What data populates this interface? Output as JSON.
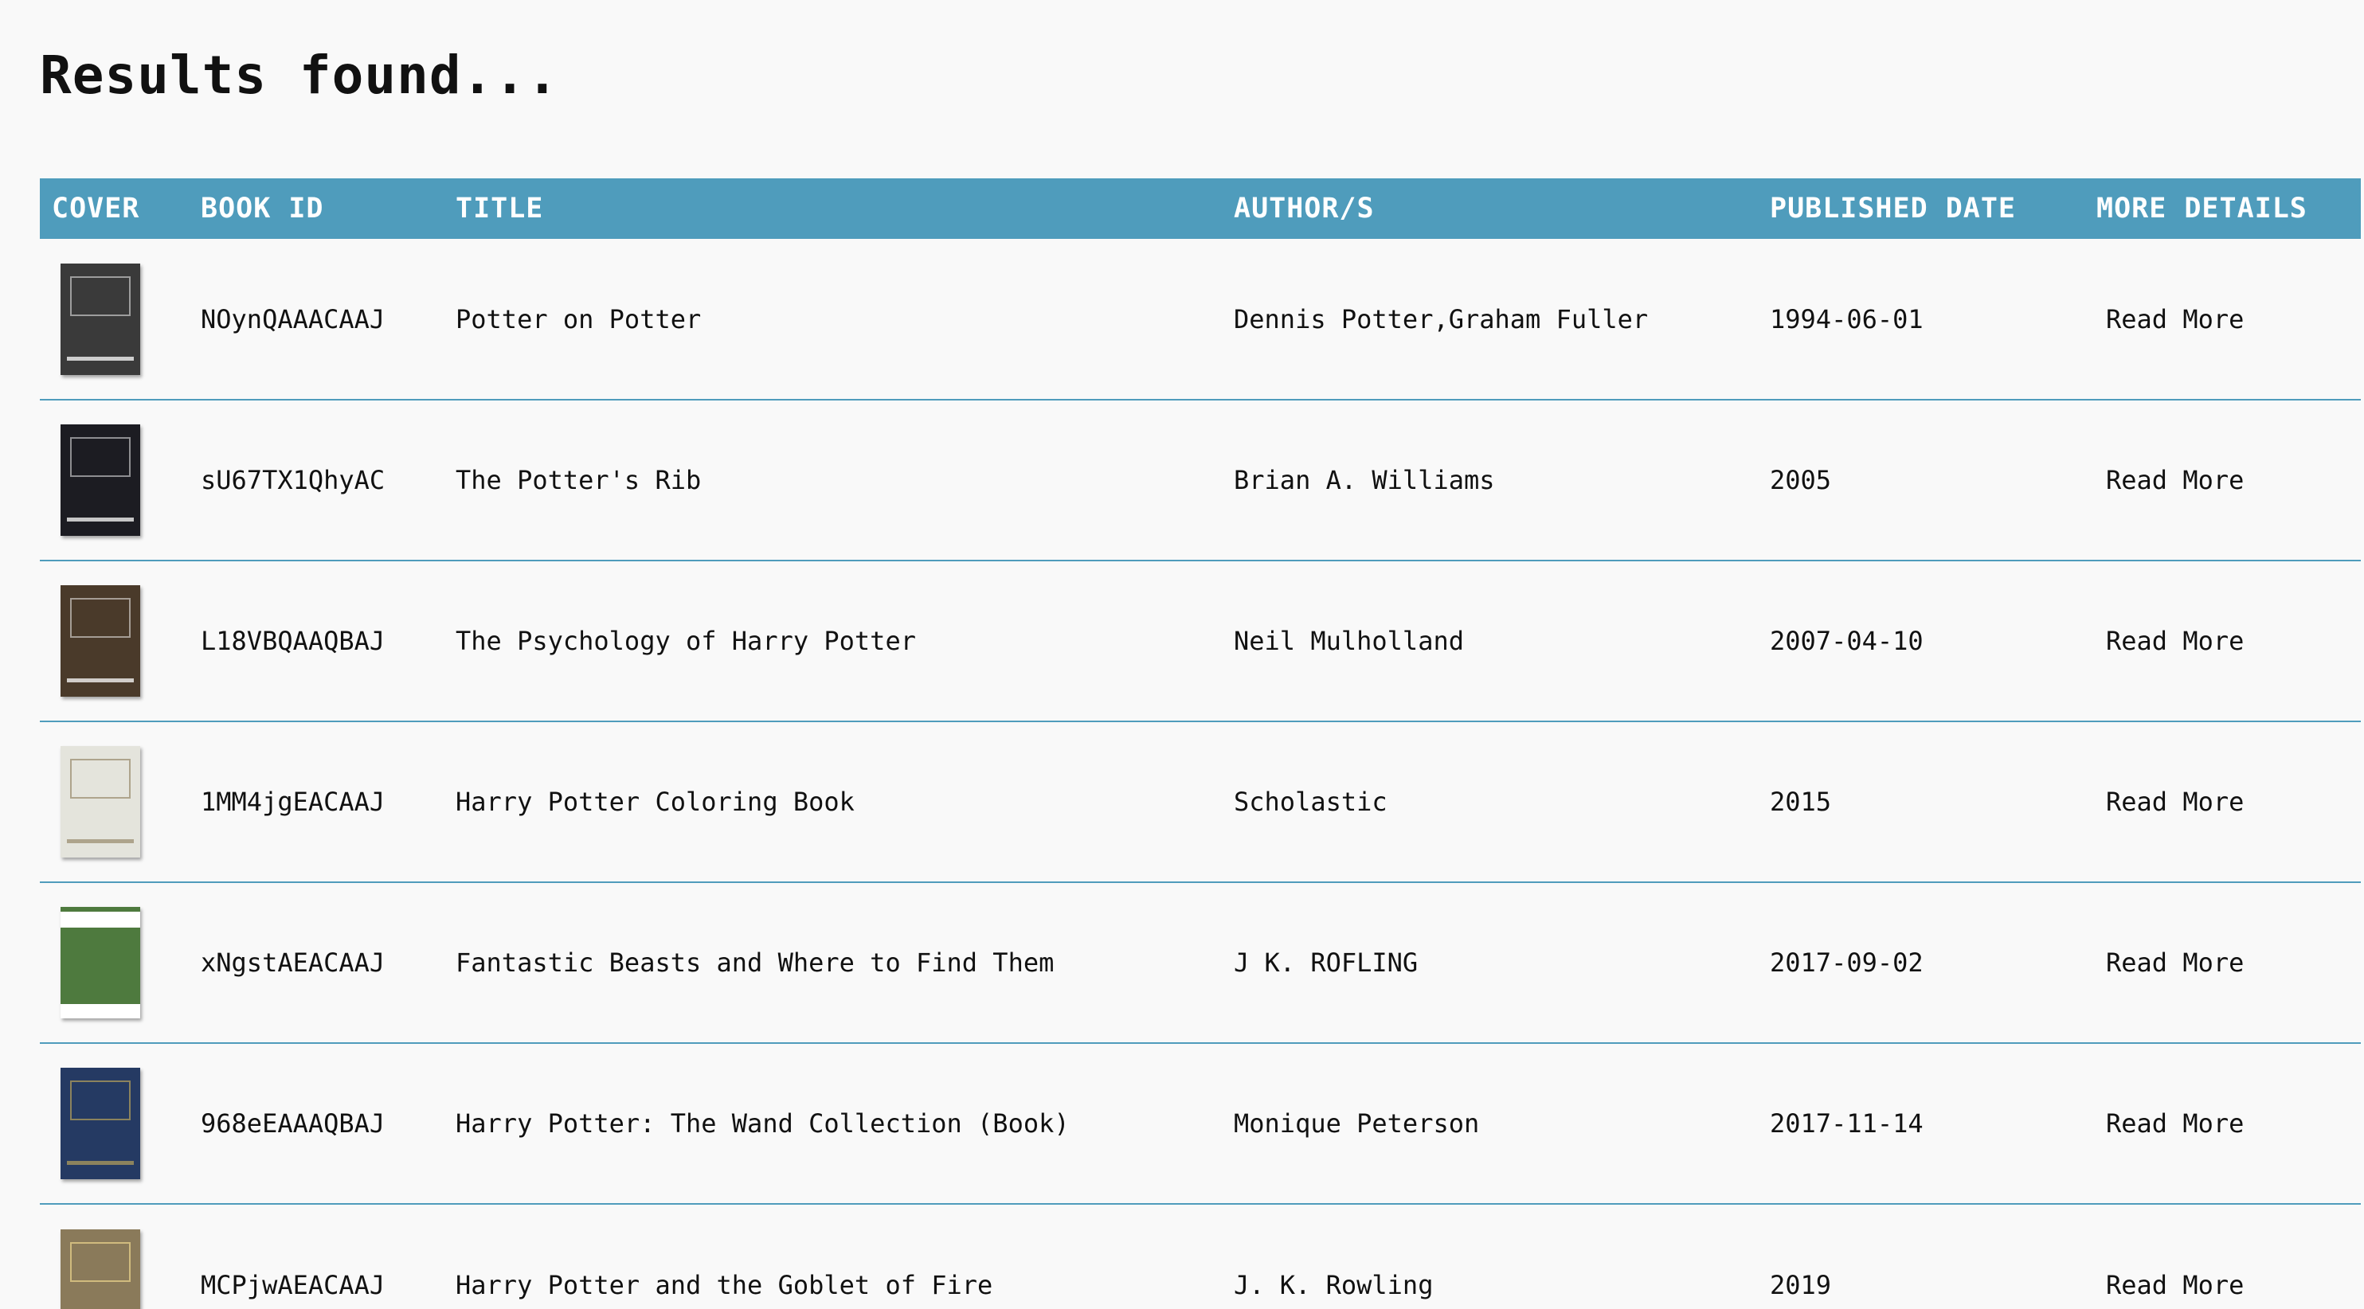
{
  "page": {
    "heading": "Results found..."
  },
  "table": {
    "columns": [
      "COVER",
      "BOOK ID",
      "TITLE",
      "AUTHOR/S",
      "PUBLISHED DATE",
      "MORE DETAILS"
    ],
    "rows": [
      {
        "id": "NOynQAAACAAJ",
        "title": "Potter on Potter",
        "authors": "Dennis Potter,Graham Fuller",
        "date": "1994-06-01",
        "more": "Read More",
        "cover_color": "#3a3a3a"
      },
      {
        "id": "sU67TX1QhyAC",
        "title": "The Potter's Rib",
        "authors": "Brian A. Williams",
        "date": "2005",
        "more": "Read More",
        "cover_color": "#1c1c22"
      },
      {
        "id": "L18VBQAAQBAJ",
        "title": "The Psychology of Harry Potter",
        "authors": "Neil Mulholland",
        "date": "2007-04-10",
        "more": "Read More",
        "cover_color": "#4a3a2a"
      },
      {
        "id": "1MM4jgEACAAJ",
        "title": "Harry Potter Coloring Book",
        "authors": "Scholastic",
        "date": "2015",
        "more": "Read More",
        "cover_color": "#e4e4dc"
      },
      {
        "id": "xNgstAEACAAJ",
        "title": "Fantastic Beasts and Where to Find Them",
        "authors": "J K. ROFLING",
        "date": "2017-09-02",
        "more": "Read More",
        "cover_color": "#4e7a3e"
      },
      {
        "id": "968eEAAAQBAJ",
        "title": "Harry Potter: The Wand Collection (Book)",
        "authors": "Monique Peterson",
        "date": "2017-11-14",
        "more": "Read More",
        "cover_color": "#253a63"
      },
      {
        "id": "MCPjwAEACAAJ",
        "title": "Harry Potter and the Goblet of Fire",
        "authors": "J. K. Rowling",
        "date": "2019",
        "more": "Read More",
        "cover_color": "#8a7a5a"
      }
    ]
  },
  "colors": {
    "header_bg": "#4f9cbc",
    "page_bg": "#f9f9f9"
  }
}
